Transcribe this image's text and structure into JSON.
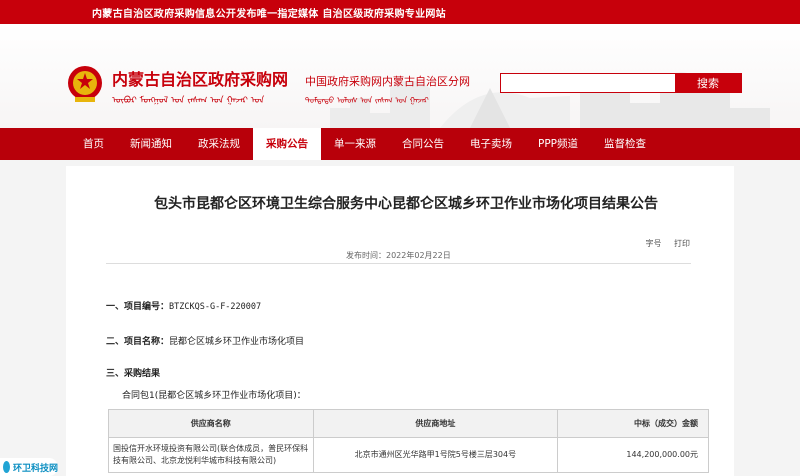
{
  "topbar": {
    "notice": "内蒙古自治区政府采购信息公开发布唯一指定媒体 自治区级政府采购专业网站"
  },
  "header": {
    "site_title": "内蒙古自治区政府采购网",
    "mongol_text": "ᠥᠪᠦᠷ ᠮᠣᠩᠭᠣᠯ ᠤᠨ ᠵᠠᠰᠠᠭ ᠤᠨ ᠭᠠᠵᠠᠷ ᠤᠨ",
    "sub_title": "中国政府采购网内蒙古自治区分网",
    "mongol_text2": "ᠳᠤᠮᠳᠠᠳᠤ ᠤᠯᠤᠰ ᠤᠨ ᠵᠠᠰᠠᠭ ᠤᠨ ᠭᠠᠵᠠᠷ",
    "search": {
      "placeholder": "",
      "button_label": "搜索"
    }
  },
  "nav": {
    "items": [
      {
        "label": "首页"
      },
      {
        "label": "新闻通知"
      },
      {
        "label": "政采法规"
      },
      {
        "label": "采购公告"
      },
      {
        "label": "单一来源"
      },
      {
        "label": "合同公告"
      },
      {
        "label": "电子卖场"
      },
      {
        "label": "PPP频道"
      },
      {
        "label": "监督检查"
      }
    ],
    "active_index": 3
  },
  "article": {
    "title": "包头市昆都仑区环境卫生综合服务中心昆都仑区城乡环卫作业市场化项目结果公告",
    "tool_font": "字号",
    "tool_print": "打印",
    "publish_time": "发布时间：2022年02月22日",
    "sec1_label": "一、项目编号：",
    "sec1_value": "BTZCKQS-G-F-220007",
    "sec2_label": "二、项目名称：",
    "sec2_value": "昆都仑区城乡环卫作业市场化项目",
    "sec3_label": "三、采购结果",
    "contract_pkg": "合同包1(昆都仑区城乡环卫作业市场化项目)："
  },
  "result_table": {
    "headers": [
      "供应商名称",
      "供应商地址",
      "中标（成交）金额"
    ],
    "rows": [
      {
        "name": "国投信开水环境投资有限公司(联合体成员，普民环保科技有限公司、北京龙悦利华城市科技有限公司)",
        "address": "北京市通州区光华路甲1号院5号楼三层304号",
        "amount": "144,200,000.00元"
      }
    ]
  },
  "badge": {
    "text": "环卫科技网"
  },
  "colors": {
    "brand_red": "#c7000b",
    "nav_red": "#b8000a",
    "badge_blue": "#21a4d4"
  }
}
